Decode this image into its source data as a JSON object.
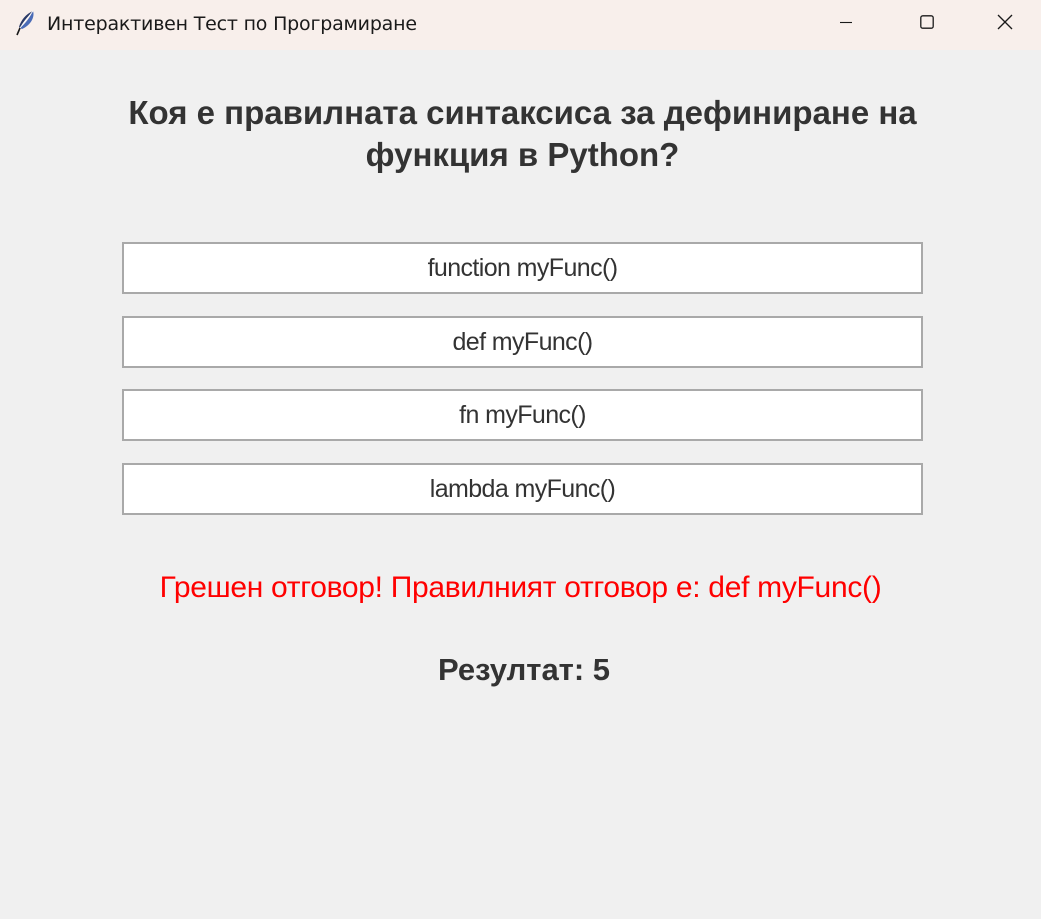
{
  "window": {
    "title": "Интерактивен Тест по Програмиране",
    "icon": "feather-icon",
    "controls": [
      "minimize-icon",
      "maximize-icon",
      "close-icon"
    ]
  },
  "quiz": {
    "question": "Коя е правилната синтаксиса за дефиниране на функция в Python?",
    "options": [
      "function myFunc()",
      "def myFunc()",
      "fn myFunc()",
      "lambda myFunc()"
    ],
    "feedback": "Грешен отговор! Правилният отговор е: def myFunc()",
    "score": "Резултат: 5"
  },
  "colors": {
    "background": "#f0f0f0",
    "titlebar": "#f8efeb",
    "text": "#333333",
    "error": "#ff0000",
    "option_border": "#a9a9a9"
  }
}
